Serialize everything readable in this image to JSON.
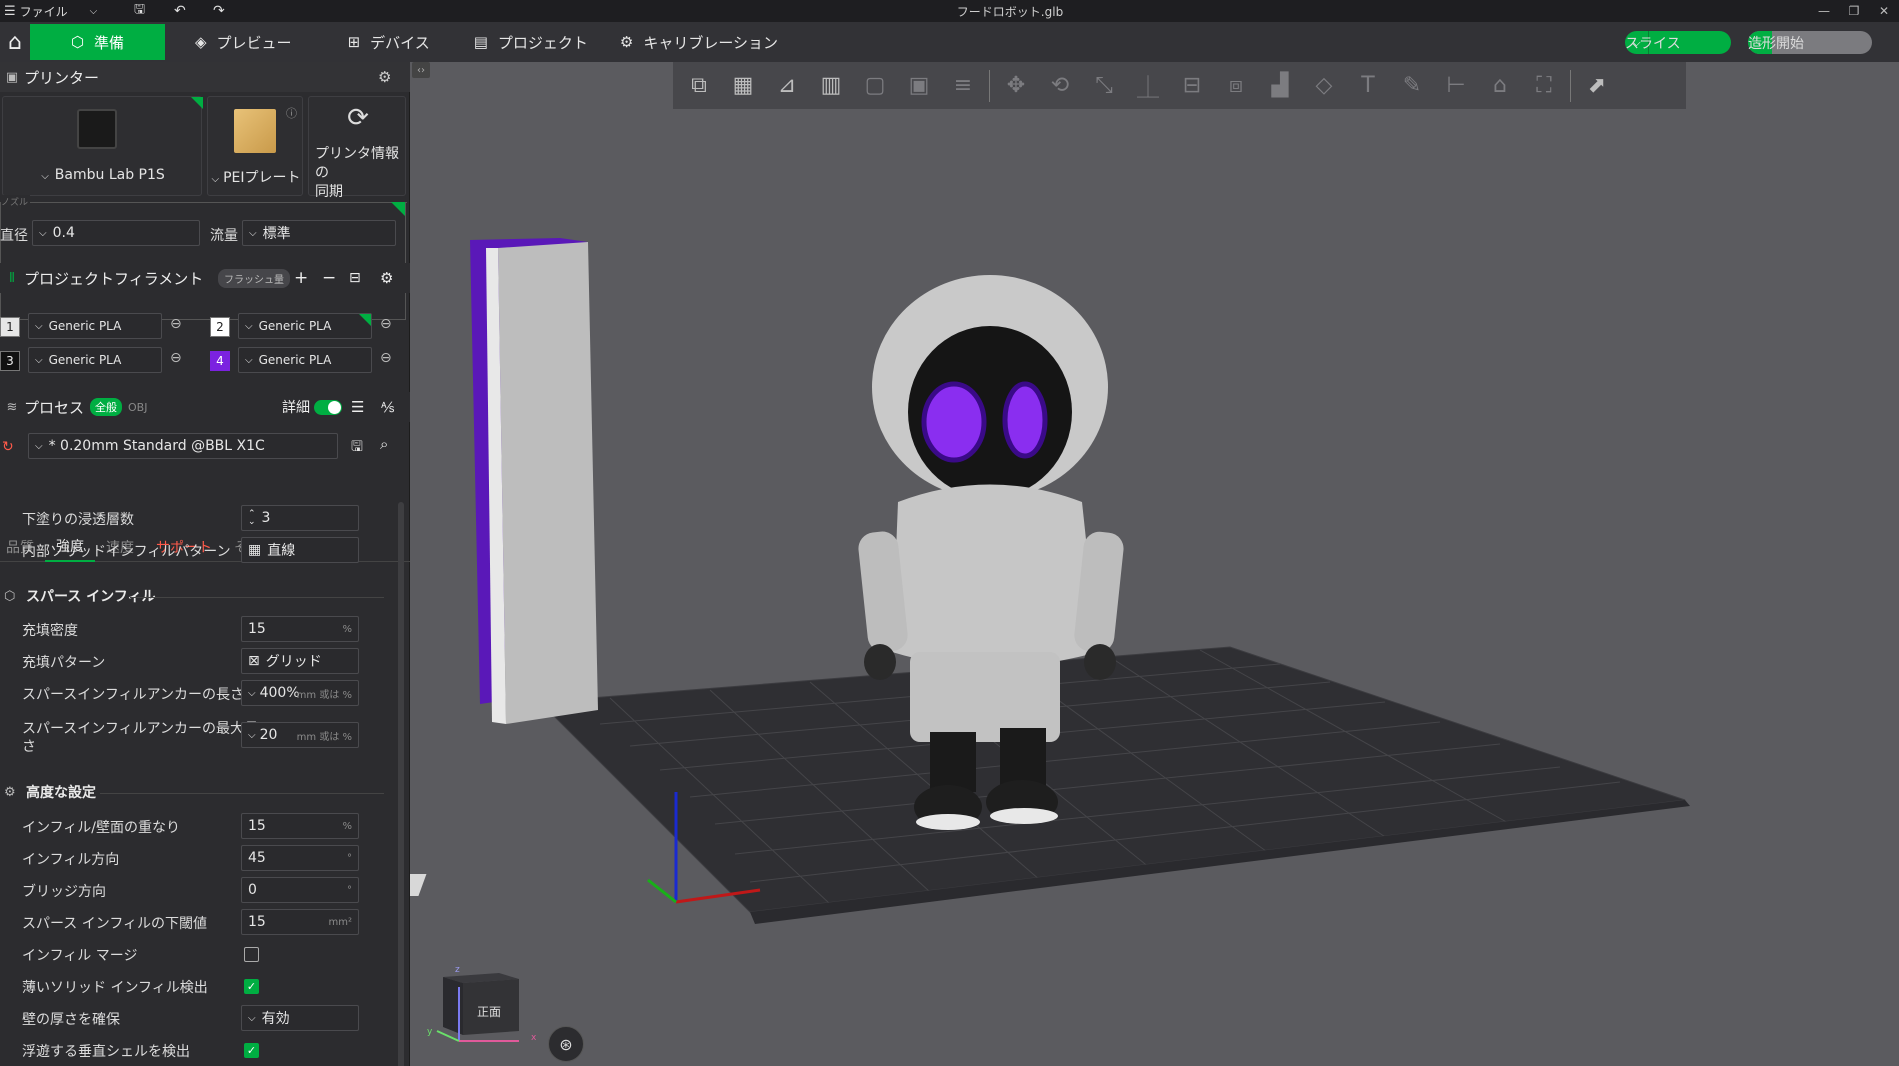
{
  "window": {
    "title": "フードロボット.glb",
    "menu_label": "ファイル"
  },
  "tabs": [
    {
      "label": "準備",
      "icon": "cube-icon"
    },
    {
      "label": "プレビュー",
      "icon": "layers-icon"
    },
    {
      "label": "デバイス",
      "icon": "device-icon"
    },
    {
      "label": "プロジェクト",
      "icon": "project-icon"
    },
    {
      "label": "キャリブレーション",
      "icon": "calibration-icon"
    }
  ],
  "actions": {
    "slice_label": "スライス",
    "print_label": "造形開始"
  },
  "printer": {
    "section_title": "プリンター",
    "printer_name": "Bambu Lab P1S",
    "plate_name": "PEIプレート",
    "sync_label_line1": "プリンタ情報の",
    "sync_label_line2": "同期",
    "nozzle_caption": "ノズル",
    "diameter_label": "直径",
    "diameter_value": "0.4",
    "flow_label": "流量",
    "flow_value": "標準"
  },
  "filament": {
    "section_title": "プロジェクトフィラメント",
    "flush_label": "フラッシュ量",
    "slots": [
      {
        "num": "1",
        "name": "Generic PLA",
        "color": "#e6e6e6"
      },
      {
        "num": "2",
        "name": "Generic PLA",
        "color": "#ffffff"
      },
      {
        "num": "3",
        "name": "Generic PLA",
        "color": "#111111"
      },
      {
        "num": "4",
        "name": "Generic PLA",
        "color": "#7b22e0"
      }
    ]
  },
  "process": {
    "section_title": "プロセス",
    "global_label": "全般",
    "obj_label": "OBJ",
    "detail_label": "詳細",
    "preset": "* 0.20mm Standard @BBL X1C",
    "subtabs": [
      "品質",
      "強度",
      "速度",
      "サポート",
      "その他"
    ]
  },
  "settings": {
    "bottom_penetration_label": "下塗りの浸透層数",
    "bottom_penetration_value": "3",
    "internal_solid_pattern_label": "内部ソリッドインフィルパターン",
    "internal_solid_pattern_value": "直線",
    "sparse_group": "スパース インフィル",
    "density_label": "充填密度",
    "density_value": "15",
    "density_unit": "%",
    "pattern_label": "充填パターン",
    "pattern_value": "グリッド",
    "anchor_len_label": "スパースインフィルアンカーの長さ",
    "anchor_len_value": "400%",
    "anchor_len_unit": "mm 或は %",
    "anchor_max_label_1": "スパースインフィルアンカーの最大長",
    "anchor_max_label_2": "さ",
    "anchor_max_value": "20",
    "anchor_max_unit": "mm 或は %",
    "advanced_group": "高度な設定",
    "overlap_label": "インフィル/壁面の重なり",
    "overlap_value": "15",
    "overlap_unit": "%",
    "infill_dir_label": "インフィル方向",
    "infill_dir_value": "45",
    "deg_unit": "°",
    "bridge_dir_label": "ブリッジ方向",
    "bridge_dir_value": "0",
    "sparse_threshold_label": "スパース インフィルの下閾値",
    "sparse_threshold_value": "15",
    "sparse_threshold_unit": "mm²",
    "infill_merge_label": "インフィル マージ",
    "infill_merge_checked": false,
    "thin_solid_label": "薄いソリッド インフィル検出",
    "thin_solid_checked": true,
    "wall_thickness_label": "壁の厚さを確保",
    "wall_thickness_value": "有効",
    "floating_shell_label": "浮遊する垂直シェルを検出",
    "floating_shell_checked": true
  },
  "viewport": {
    "navcube_face": "正面",
    "axis_x": "x",
    "axis_y": "y",
    "axis_z": "z"
  }
}
